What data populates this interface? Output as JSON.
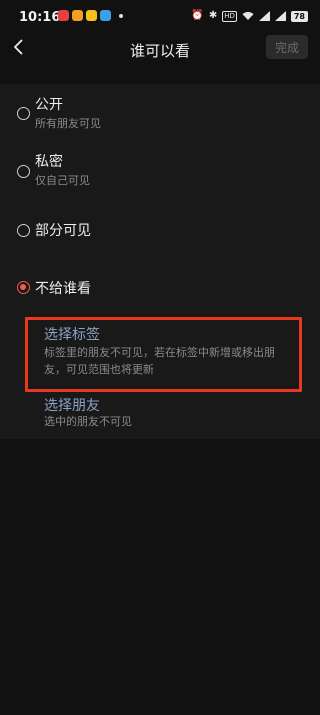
{
  "status_bar": {
    "time": "10:16",
    "app_icon_colors": [
      "#e8403a",
      "#f0a020",
      "#f5c21b",
      "#3aa0e8"
    ],
    "network_label": "HD",
    "battery": "78"
  },
  "header": {
    "title": "谁可以看",
    "done_label": "完成"
  },
  "options": [
    {
      "title": "公开",
      "desc": "所有朋友可见",
      "selected": false
    },
    {
      "title": "私密",
      "desc": "仅自己可见",
      "selected": false
    },
    {
      "title": "部分可见",
      "desc": "",
      "selected": false
    },
    {
      "title": "不给谁看",
      "desc": "",
      "selected": true
    }
  ],
  "sub_options": [
    {
      "title": "选择标签",
      "desc": "标签里的朋友不可见，若在标签中新增或移出朋友，可见范围也将更新"
    },
    {
      "title": "选择朋友",
      "desc": "选中的朋友不可见"
    }
  ],
  "colors": {
    "accent": "#f25c50",
    "highlight": "#e8381f",
    "link": "#8aa3c4"
  }
}
